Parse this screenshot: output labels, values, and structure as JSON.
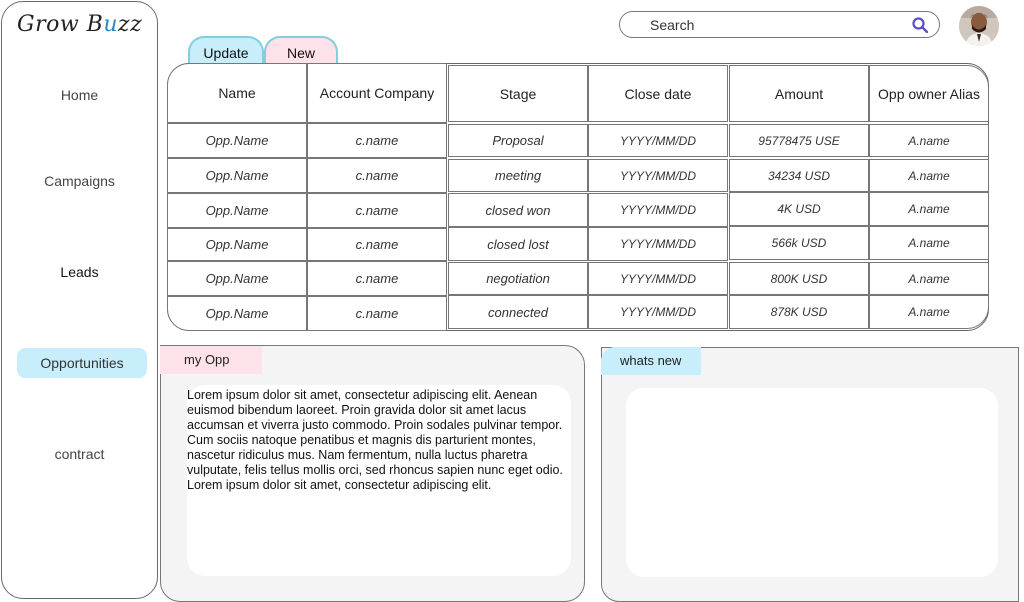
{
  "app": {
    "logo_left": "Grow B",
    "logo_u": "u",
    "logo_right": "zz"
  },
  "sidebar": {
    "items": [
      {
        "label": "Home"
      },
      {
        "label": "Campaigns"
      },
      {
        "label": "Leads"
      },
      {
        "label": "Opportunities",
        "active": true
      },
      {
        "label": "contract"
      }
    ]
  },
  "search": {
    "label": "Search",
    "icon": "search-icon"
  },
  "tabs": [
    {
      "label": "Update"
    },
    {
      "label": "New"
    }
  ],
  "table": {
    "headers": [
      "Name",
      "Account Company",
      "Stage",
      "Close date",
      "Amount",
      "Opp owner Alias"
    ],
    "rows": [
      [
        "Opp.Name",
        "c.name",
        "Proposal",
        "YYYY/MM/DD",
        "95778475 USE",
        "A.name"
      ],
      [
        "Opp.Name",
        "c.name",
        "meeting",
        "YYYY/MM/DD",
        "34234 USD",
        "A.name"
      ],
      [
        "Opp.Name",
        "c.name",
        "closed won",
        "YYYY/MM/DD",
        "4K USD",
        "A.name"
      ],
      [
        "Opp.Name",
        "c.name",
        "closed lost",
        "YYYY/MM/DD",
        "566k USD",
        "A.name"
      ],
      [
        "Opp.Name",
        "c.name",
        "negotiation",
        "YYYY/MM/DD",
        "800K USD",
        "A.name"
      ],
      [
        "Opp.Name",
        "c.name",
        "connected",
        "YYYY/MM/DD",
        "878K USD",
        "A.name"
      ]
    ]
  },
  "panels": {
    "my_opp": {
      "title": "my Opp",
      "body": "Lorem ipsum dolor sit amet, consectetur adipiscing elit. Aenean euismod bibendum laoreet. Proin gravida dolor sit amet lacus accumsan et viverra justo commodo. Proin sodales pulvinar tempor. Cum sociis natoque penatibus et magnis dis parturient montes, nascetur ridiculus mus. Nam fermentum, nulla luctus pharetra vulputate, felis tellus mollis orci, sed rhoncus sapien nunc eget odio. Lorem ipsum dolor sit amet, consectetur adipiscing elit."
    },
    "whats_new": {
      "title": "whats new"
    }
  },
  "colors": {
    "accent_blue": "#c9eefb",
    "accent_pink": "#fde2ea",
    "search_icon": "#5a4fc8"
  }
}
